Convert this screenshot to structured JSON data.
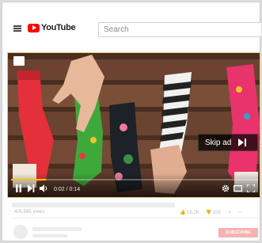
{
  "header": {
    "logo_text": "YouTube",
    "search_placeholder": "Search"
  },
  "player": {
    "skip_ad_label": "Skip ad",
    "time_current": "0:02",
    "time_separator": " / ",
    "time_total": "0:14",
    "progress": 0.14,
    "accent_color": "#f8c300"
  },
  "video_meta": {
    "views": "405,585 views",
    "likes": "16,2K",
    "dislikes": "100",
    "subscribe_label": "SUBSCRIBE"
  }
}
